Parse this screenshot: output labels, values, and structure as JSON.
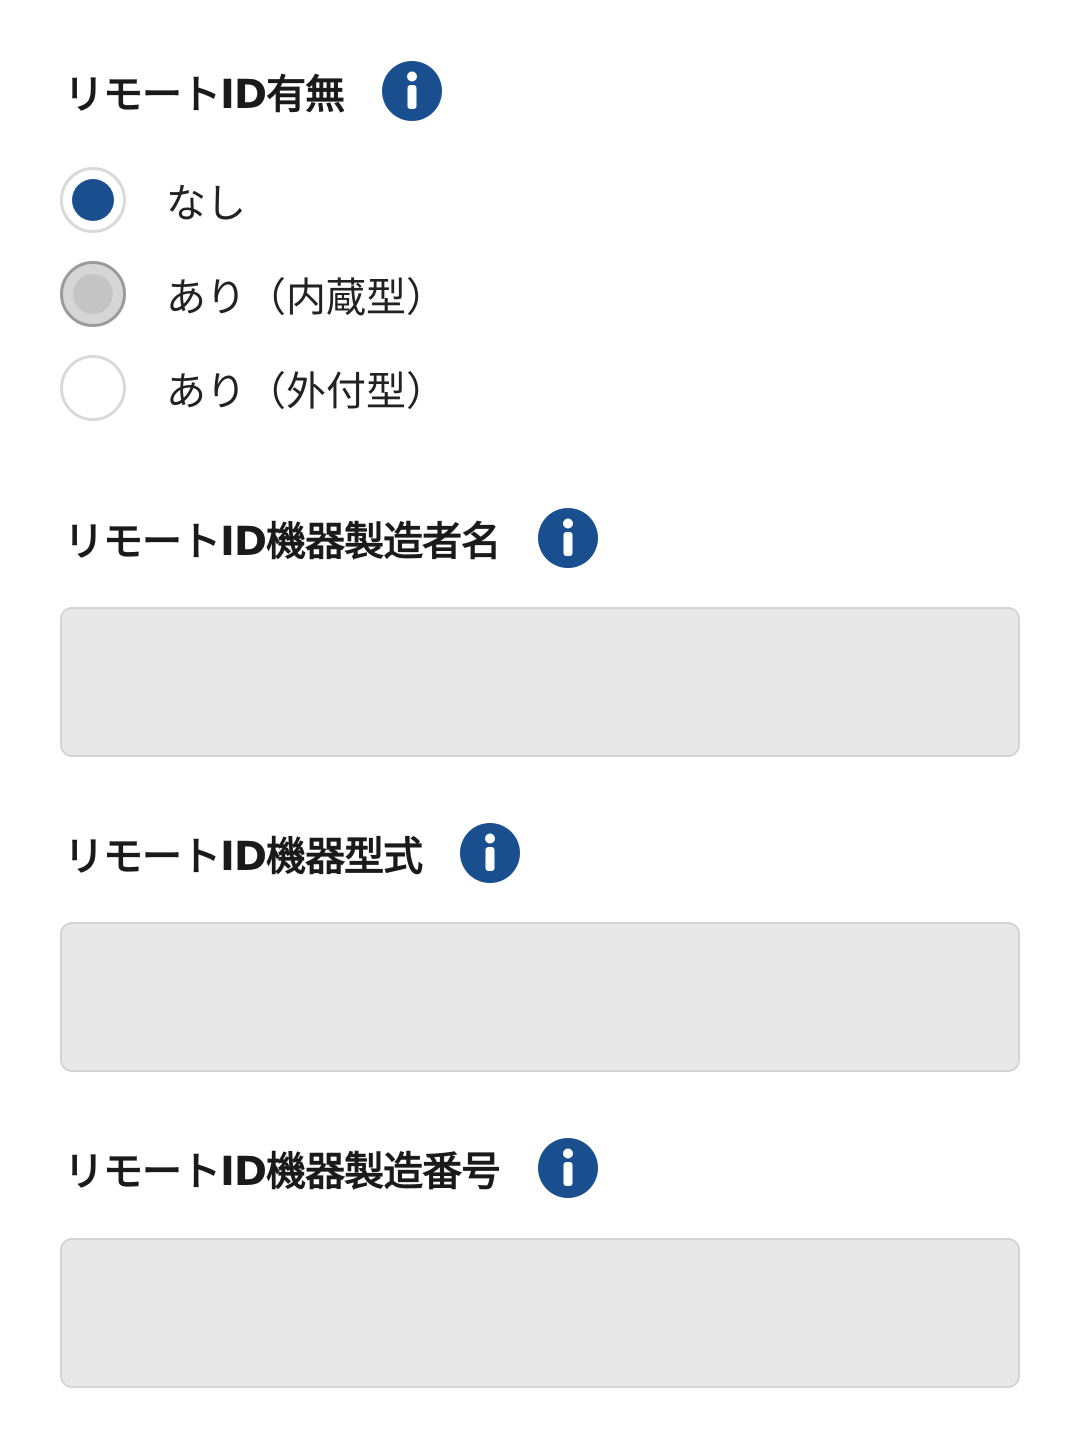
{
  "remote_id_presence": {
    "label": "リモートID有無",
    "info_icon": "info-icon",
    "options": [
      {
        "label": "なし",
        "state": "checked"
      },
      {
        "label": "あり（内蔵型）",
        "state": "disabled"
      },
      {
        "label": "あり（外付型）",
        "state": "unchecked"
      }
    ]
  },
  "manufacturer": {
    "label": "リモートID機器製造者名",
    "info_icon": "info-icon",
    "value": "",
    "placeholder": ""
  },
  "model": {
    "label": "リモートID機器型式",
    "info_icon": "info-icon",
    "value": "",
    "placeholder": ""
  },
  "serial_number": {
    "label": "リモートID機器製造番号",
    "info_icon": "info-icon",
    "value": "",
    "placeholder": ""
  },
  "colors": {
    "accent": "#1a4f8f",
    "field_background": "#e8e8e8",
    "field_border": "#d4d4d4"
  }
}
